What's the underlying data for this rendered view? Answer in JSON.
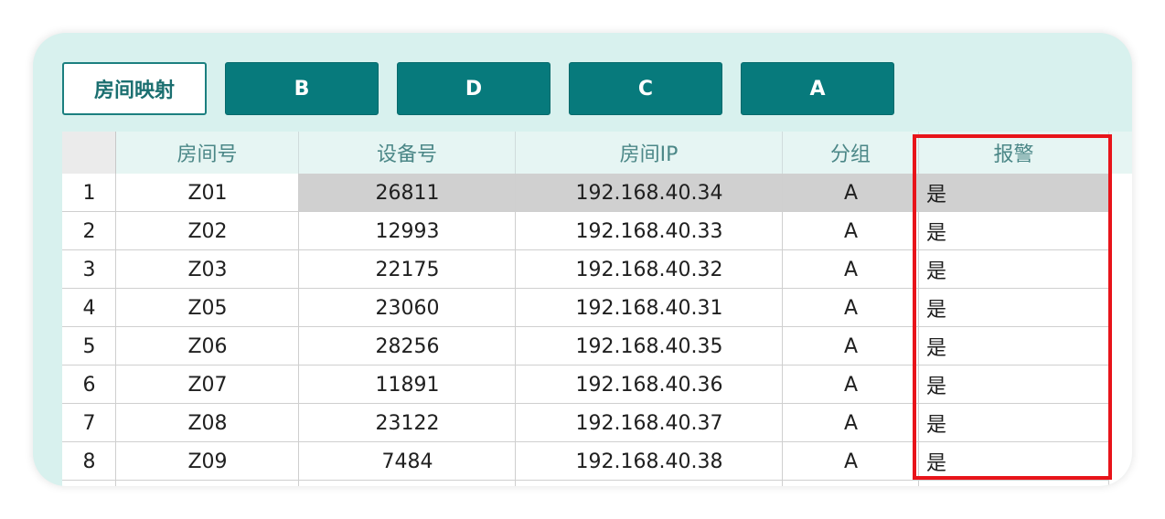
{
  "toolbar": {
    "mapping_label": "房间映射",
    "buttons": [
      "B",
      "D",
      "C",
      "A"
    ]
  },
  "table": {
    "columns": [
      "房间号",
      "设备号",
      "房间IP",
      "分组",
      "报警"
    ],
    "rows": [
      {
        "num": "1",
        "room": "Z01",
        "device": "26811",
        "ip": "192.168.40.34",
        "group": "A",
        "alarm": "是"
      },
      {
        "num": "2",
        "room": "Z02",
        "device": "12993",
        "ip": "192.168.40.33",
        "group": "A",
        "alarm": "是"
      },
      {
        "num": "3",
        "room": "Z03",
        "device": "22175",
        "ip": "192.168.40.32",
        "group": "A",
        "alarm": "是"
      },
      {
        "num": "4",
        "room": "Z05",
        "device": "23060",
        "ip": "192.168.40.31",
        "group": "A",
        "alarm": "是"
      },
      {
        "num": "5",
        "room": "Z06",
        "device": "28256",
        "ip": "192.168.40.35",
        "group": "A",
        "alarm": "是"
      },
      {
        "num": "6",
        "room": "Z07",
        "device": "11891",
        "ip": "192.168.40.36",
        "group": "A",
        "alarm": "是"
      },
      {
        "num": "7",
        "room": "Z08",
        "device": "23122",
        "ip": "192.168.40.37",
        "group": "A",
        "alarm": "是"
      },
      {
        "num": "8",
        "room": "Z09",
        "device": "7484",
        "ip": "192.168.40.38",
        "group": "A",
        "alarm": "是"
      }
    ]
  },
  "colors": {
    "accent": "#077a7c",
    "background": "#d8f1ee",
    "highlight": "#e8141a"
  }
}
